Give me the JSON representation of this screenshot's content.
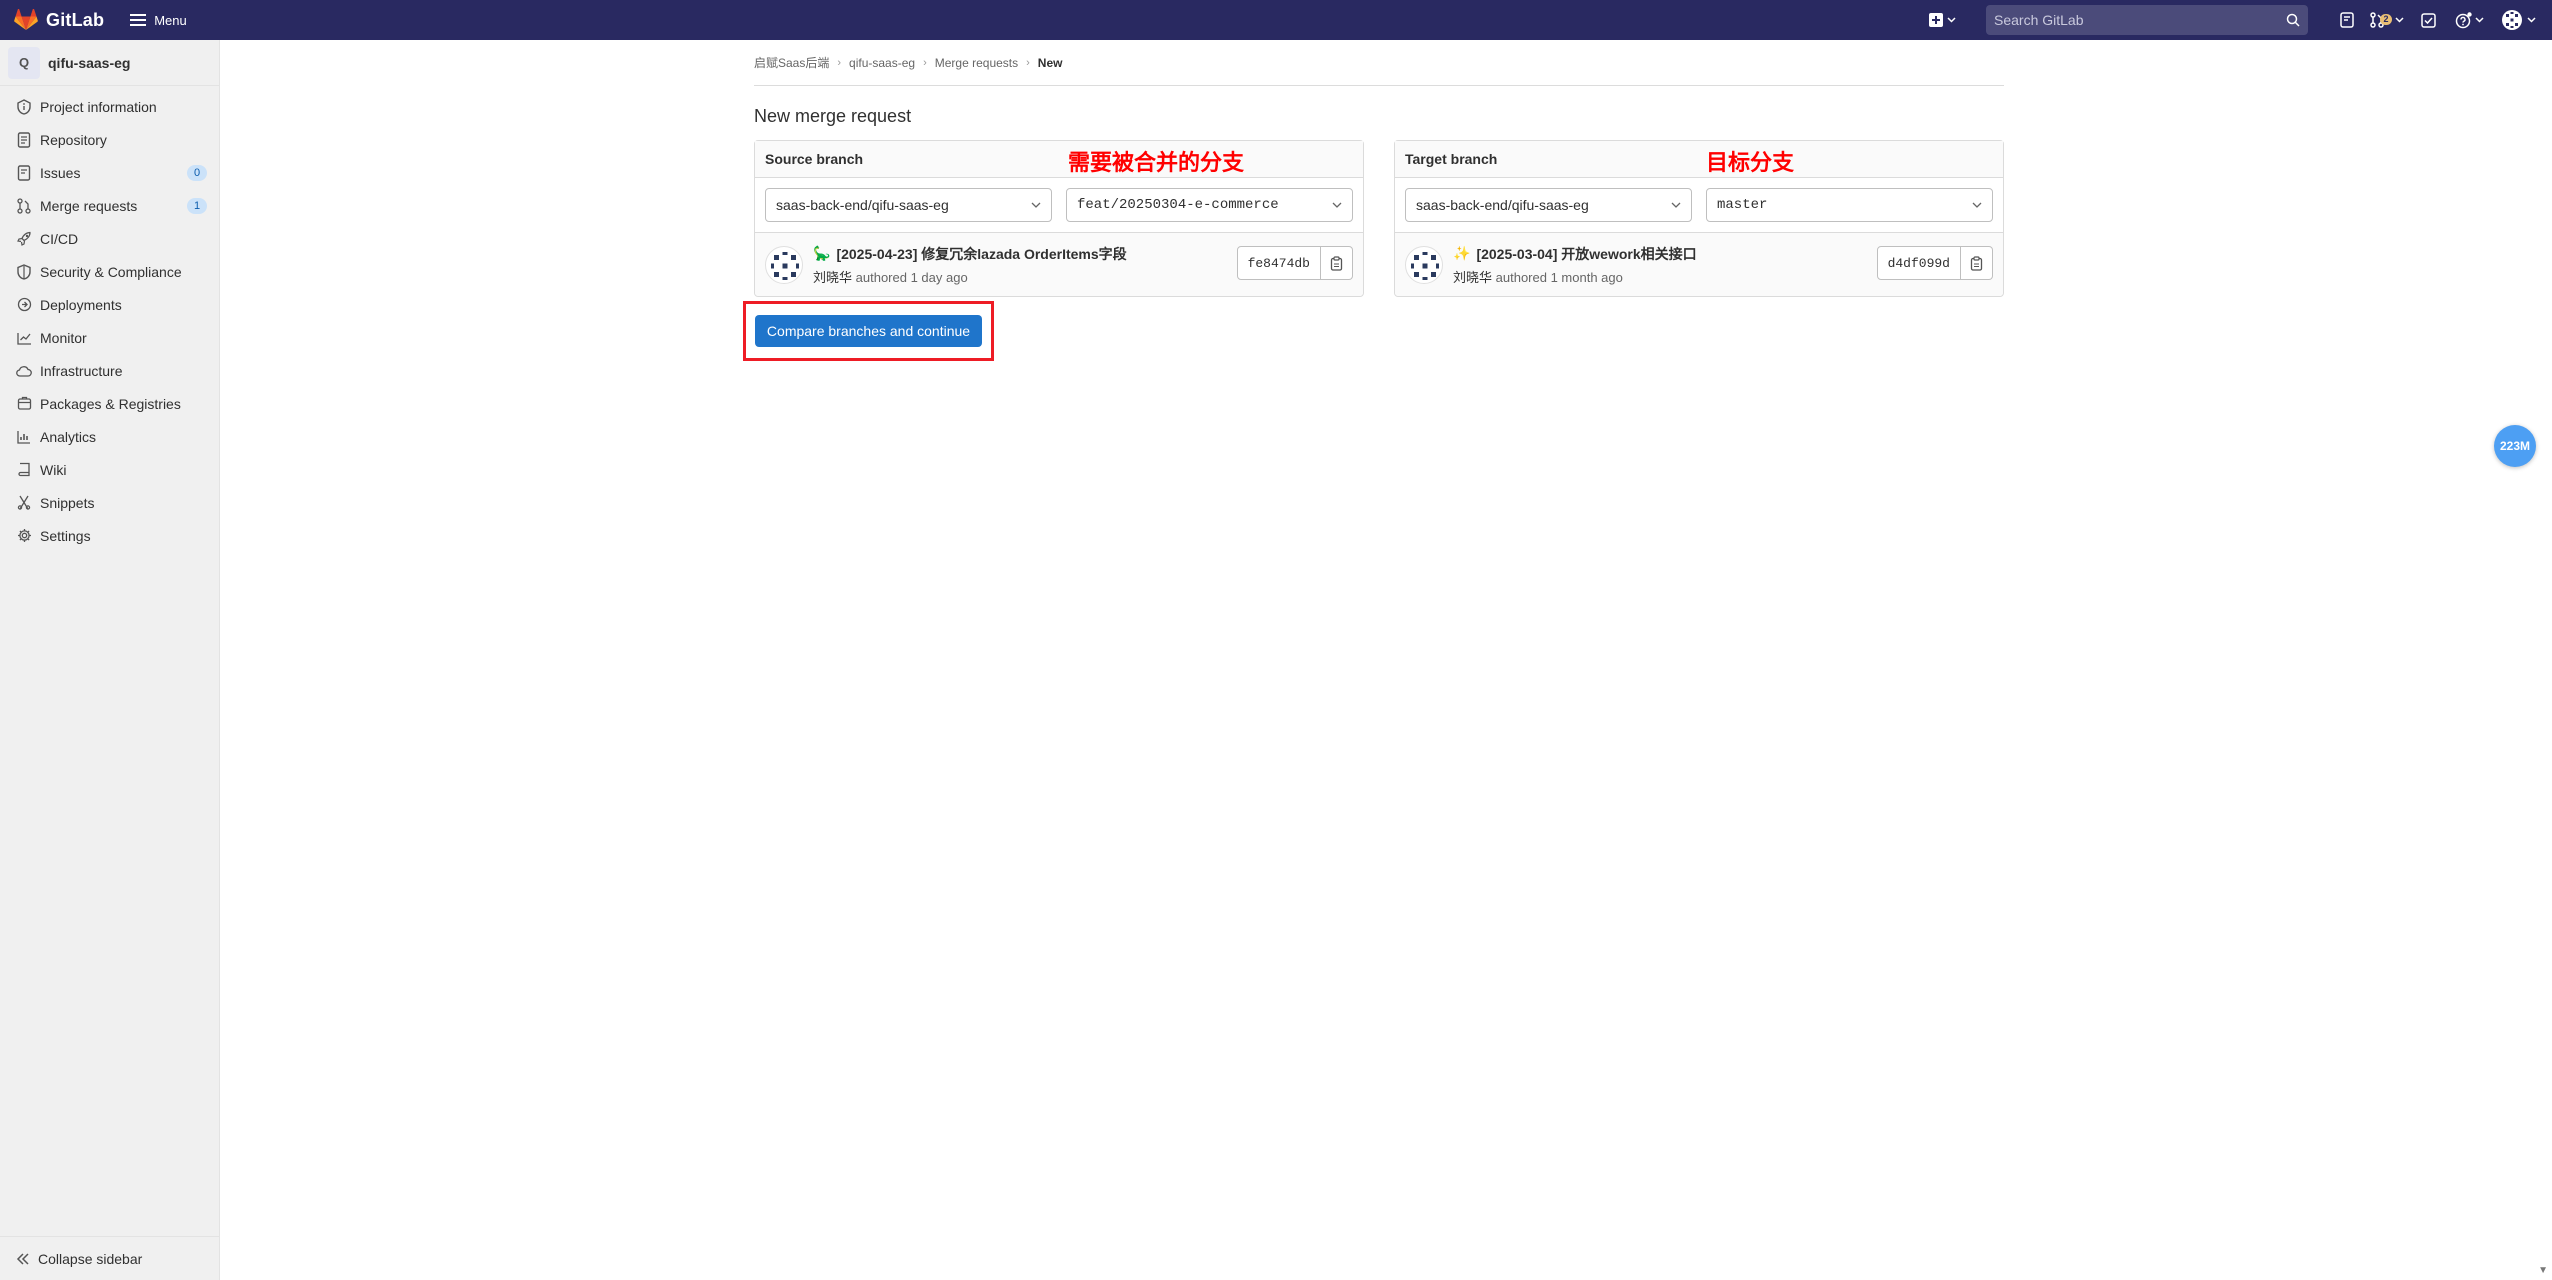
{
  "navbar": {
    "brand": "GitLab",
    "menu_label": "Menu",
    "search_placeholder": "Search GitLab",
    "mr_count": "2"
  },
  "sidebar": {
    "project_initial": "Q",
    "project_name": "qifu-saas-eg",
    "items": [
      {
        "label": "Project information",
        "icon": "info-icon"
      },
      {
        "label": "Repository",
        "icon": "doc-icon"
      },
      {
        "label": "Issues",
        "icon": "issues-icon",
        "count": "0"
      },
      {
        "label": "Merge requests",
        "icon": "merge-request-icon",
        "count": "1"
      },
      {
        "label": "CI/CD",
        "icon": "rocket-icon"
      },
      {
        "label": "Security & Compliance",
        "icon": "shield-icon"
      },
      {
        "label": "Deployments",
        "icon": "deployments-icon"
      },
      {
        "label": "Monitor",
        "icon": "monitor-icon"
      },
      {
        "label": "Infrastructure",
        "icon": "cloud-icon"
      },
      {
        "label": "Packages & Registries",
        "icon": "package-icon"
      },
      {
        "label": "Analytics",
        "icon": "chart-icon"
      },
      {
        "label": "Wiki",
        "icon": "book-icon"
      },
      {
        "label": "Snippets",
        "icon": "snippet-icon"
      },
      {
        "label": "Settings",
        "icon": "gear-icon"
      }
    ],
    "collapse_label": "Collapse sidebar"
  },
  "breadcrumb": [
    "启赋Saas后端",
    "qifu-saas-eg",
    "Merge requests",
    "New"
  ],
  "page_title": "New merge request",
  "source": {
    "title": "Source branch",
    "annotation": "需要被合并的分支",
    "project": "saas-back-end/qifu-saas-eg",
    "branch": "feat/20250304-e-commerce",
    "commit_emoji": "🦕",
    "commit_title": "[2025-04-23] 修复冗余lazada OrderItems字段",
    "author": "刘晓华",
    "authored": "authored 1 day ago",
    "sha": "fe8474db"
  },
  "target": {
    "title": "Target branch",
    "annotation": "目标分支",
    "project": "saas-back-end/qifu-saas-eg",
    "branch": "master",
    "commit_emoji": "✨",
    "commit_title": "[2025-03-04] 开放wework相关接口",
    "author": "刘晓华",
    "authored": "authored 1 month ago",
    "sha": "d4df099d"
  },
  "compare_button": "Compare branches and continue",
  "float_badge": "223M",
  "colors": {
    "navbar": "#292961",
    "primary": "#1f75cb",
    "annotation": "#ff0000"
  }
}
